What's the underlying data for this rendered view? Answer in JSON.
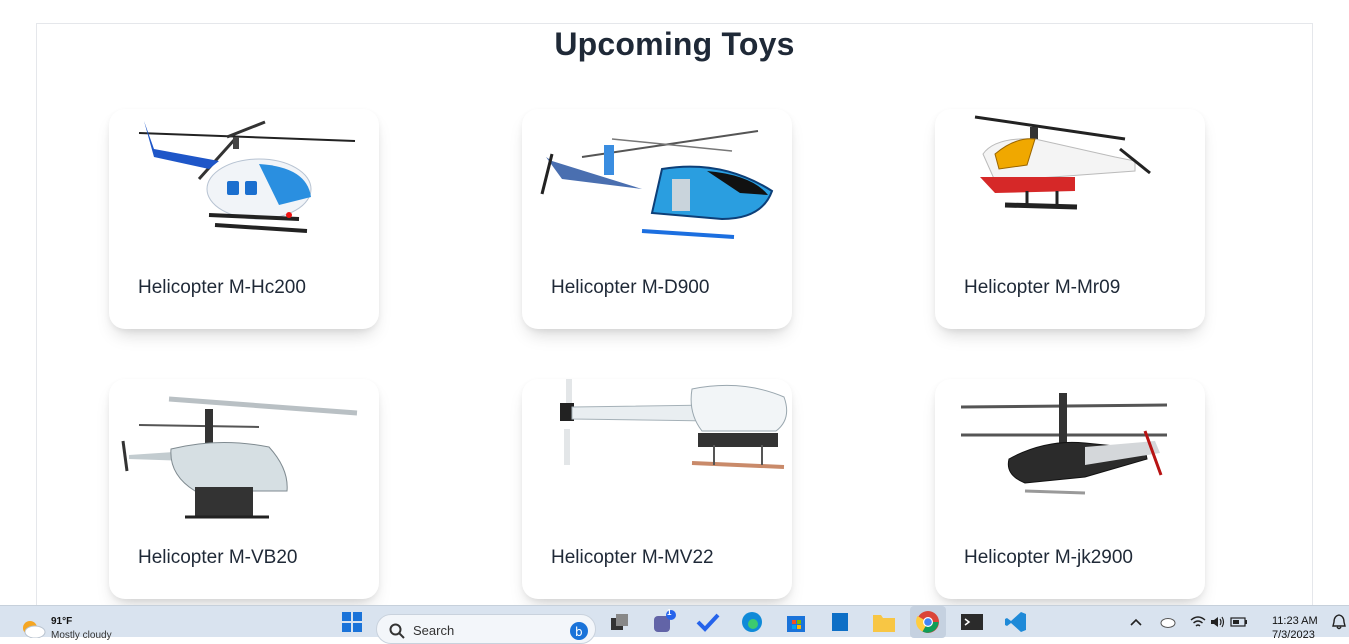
{
  "section": {
    "title": "Upcoming Toys"
  },
  "toys": [
    {
      "name": "Helicopter M-Hc200"
    },
    {
      "name": "Helicopter M-D900"
    },
    {
      "name": "Helicopter M-Mr09"
    },
    {
      "name": "Helicopter M-VB20"
    },
    {
      "name": "Helicopter M-MV22"
    },
    {
      "name": "Helicopter M-jk2900"
    }
  ],
  "taskbar": {
    "weather": {
      "temp": "91°F",
      "desc": "Mostly cloudy"
    },
    "search": {
      "placeholder": "Search"
    },
    "apps": [
      "start-icon",
      "search-icon",
      "task-view-icon",
      "teams-icon",
      "todo-icon",
      "edge-icon",
      "store-icon",
      "files-icon",
      "explorer-icon",
      "chrome-icon",
      "terminal-icon",
      "vscode-icon"
    ],
    "teams_badge": "1",
    "clock": {
      "time": "11:23 AM",
      "date": "7/3/2023"
    }
  }
}
